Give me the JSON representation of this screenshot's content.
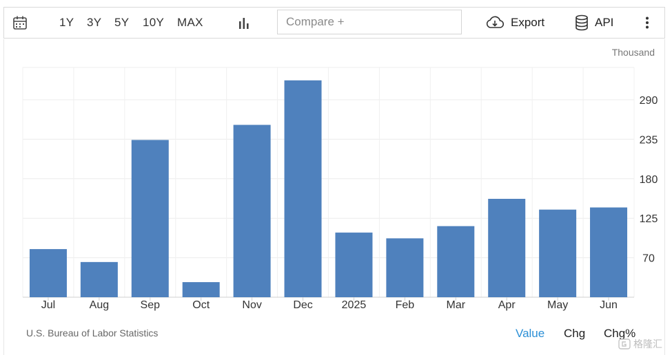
{
  "toolbar": {
    "calendar_icon": "calendar-icon",
    "ranges": [
      "1Y",
      "3Y",
      "5Y",
      "10Y",
      "MAX"
    ],
    "chart_type_icon": "bar-chart-icon",
    "compare_placeholder": "Compare +",
    "export_icon": "cloud-download-icon",
    "export_label": "Export",
    "api_icon": "database-icon",
    "api_label": "API",
    "more_icon": "vertical-dots-icon"
  },
  "chart_data": {
    "type": "bar",
    "unit_label": "Thousand",
    "categories": [
      "Jul",
      "Aug",
      "Sep",
      "Oct",
      "Nov",
      "Dec",
      "2025",
      "Feb",
      "Mar",
      "Apr",
      "May",
      "Jun"
    ],
    "values": [
      82,
      64,
      234,
      36,
      255,
      317,
      105,
      97,
      114,
      152,
      137,
      140
    ],
    "y_ticks": [
      70,
      125,
      180,
      235,
      290
    ],
    "ylim": [
      15,
      335
    ],
    "bar_color": "#4f81bd",
    "grid": true,
    "y_axis_side": "right"
  },
  "footer": {
    "source": "U.S. Bureau of Labor Statistics",
    "modes": [
      "Value",
      "Chg",
      "Chg%"
    ],
    "active_mode": "Value",
    "active_color": "#2b8fd6",
    "watermark": "格隆汇"
  }
}
